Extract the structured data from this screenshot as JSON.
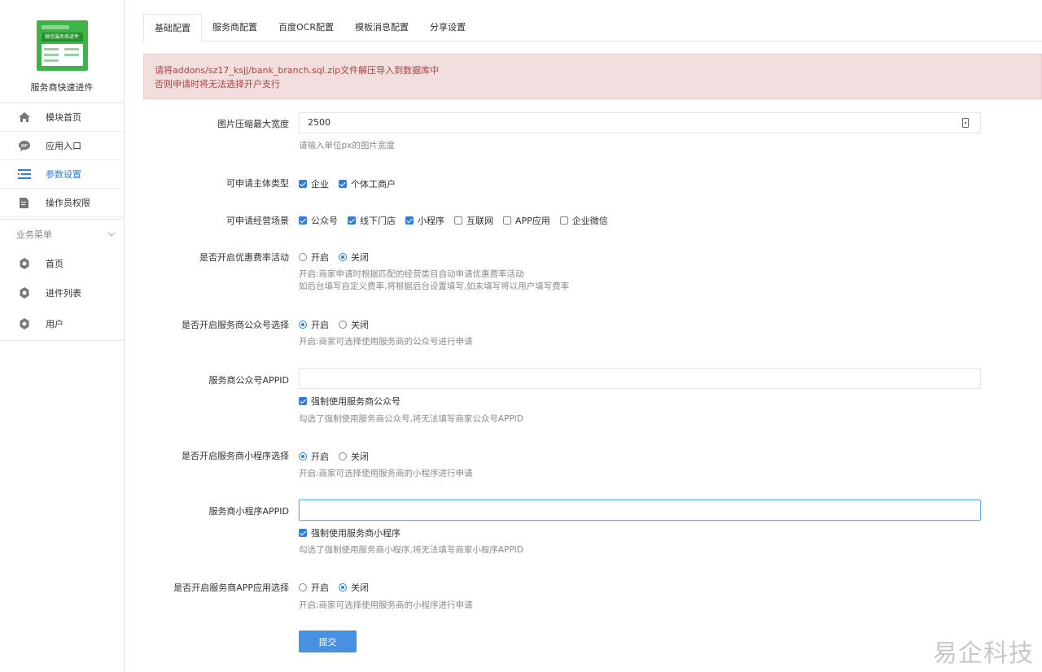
{
  "sidebar": {
    "logo_text": "微信服务商进件",
    "title": "服务商快速进件",
    "items": [
      {
        "label": "模块首页",
        "icon": "home-icon",
        "active": false
      },
      {
        "label": "应用入口",
        "icon": "chat-bubble-icon",
        "active": false
      },
      {
        "label": "参数设置",
        "icon": "list-settings-icon",
        "active": true
      },
      {
        "label": "操作员权限",
        "icon": "edit-document-icon",
        "active": false
      }
    ],
    "group": {
      "label": "业务菜单",
      "items": [
        {
          "label": "首页",
          "icon": "gear-icon"
        },
        {
          "label": "进件列表",
          "icon": "gear-icon"
        },
        {
          "label": "用户",
          "icon": "gear-icon"
        }
      ]
    }
  },
  "tabs": [
    {
      "label": "基础配置",
      "active": true
    },
    {
      "label": "服务商配置",
      "active": false
    },
    {
      "label": "百度OCR配置",
      "active": false
    },
    {
      "label": "模板消息配置",
      "active": false
    },
    {
      "label": "分享设置",
      "active": false
    }
  ],
  "alert": {
    "line1": "请将addons/sz17_ksjj/bank_branch.sql.zip文件解压导入到数据库中",
    "line2": "否则申请时将无法选择开户支行"
  },
  "form": {
    "img_width": {
      "label": "图片压缩最大宽度",
      "value": "2500",
      "help": "请输入单位px的图片宽度"
    },
    "subject_type": {
      "label": "可申请主体类型",
      "options": [
        {
          "label": "企业",
          "checked": true
        },
        {
          "label": "个体工商户",
          "checked": true
        }
      ]
    },
    "scene": {
      "label": "可申请经营场景",
      "options": [
        {
          "label": "公众号",
          "checked": true
        },
        {
          "label": "线下门店",
          "checked": true
        },
        {
          "label": "小程序",
          "checked": true
        },
        {
          "label": "互联网",
          "checked": false
        },
        {
          "label": "APP应用",
          "checked": false
        },
        {
          "label": "企业微信",
          "checked": false
        }
      ]
    },
    "discount": {
      "label": "是否开启优惠费率活动",
      "on_label": "开启",
      "off_label": "关闭",
      "selected": "off",
      "help1": "开启:商家申请时根据匹配的经营类目自动申请优惠费率活动",
      "help2": "如后台填写自定义费率,将根据后台设置填写,如未填写将以用户填写费率"
    },
    "mp_select": {
      "label": "是否开启服务商公众号选择",
      "on_label": "开启",
      "off_label": "关闭",
      "selected": "on",
      "help": "开启:商家可选择使用服务商的公众号进行申请"
    },
    "mp_appid": {
      "label": "服务商公众号APPID",
      "value": "",
      "force_label": "强制使用服务商公众号",
      "force_checked": true,
      "help": "勾选了强制使用服务商公众号,将无法填写商家公众号APPID"
    },
    "mini_select": {
      "label": "是否开启服务商小程序选择",
      "on_label": "开启",
      "off_label": "关闭",
      "selected": "on",
      "help": "开启:商家可选择使用服务商的小程序进行申请"
    },
    "mini_appid": {
      "label": "服务商小程序APPID",
      "value": "",
      "force_label": "强制使用服务商小程序",
      "force_checked": true,
      "help": "勾选了强制使用服务商小程序,将无法填写商家小程序APPID"
    },
    "app_select": {
      "label": "是否开启服务商APP应用选择",
      "on_label": "开启",
      "off_label": "关闭",
      "selected": "off",
      "help": "开启:商家可选择使用服务商的小程序进行申请"
    },
    "submit_label": "提交"
  },
  "watermark": "易企科技",
  "colors": {
    "accent": "#2f7de1",
    "alert_bg": "#f2dede",
    "alert_text": "#a94442",
    "button": "#4a90e2"
  }
}
